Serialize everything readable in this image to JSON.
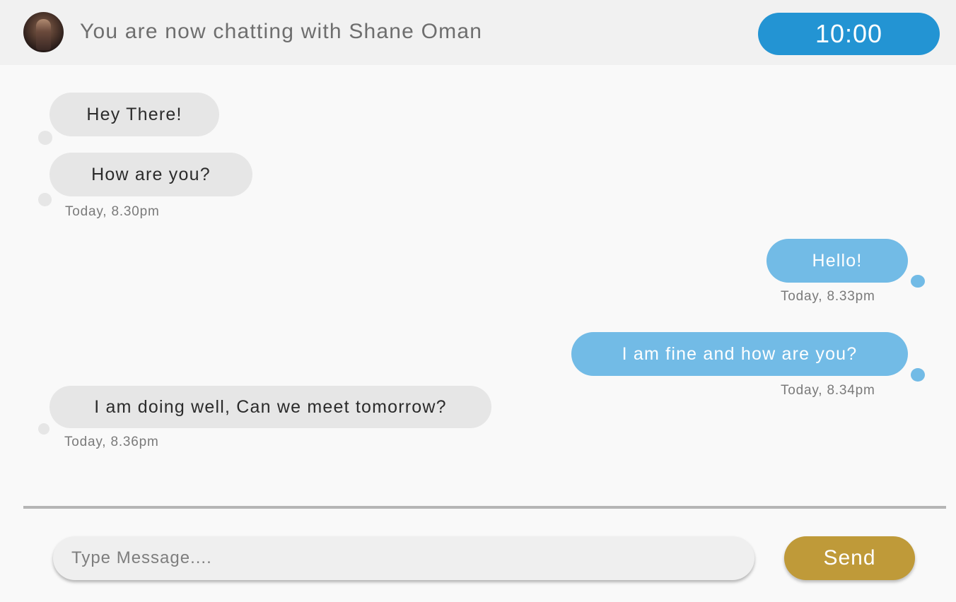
{
  "header": {
    "title": "You are now chatting with Shane Oman",
    "timer": "10:00",
    "avatar_icon": "avatar-photo"
  },
  "messages": [
    {
      "direction": "incoming",
      "text": "Hey There!"
    },
    {
      "direction": "incoming",
      "text": "How are you?",
      "timestamp": "Today, 8.30pm"
    },
    {
      "direction": "outgoing",
      "text": "Hello!",
      "timestamp": "Today, 8.33pm"
    },
    {
      "direction": "outgoing",
      "text": "I am fine and how are you?",
      "timestamp": "Today, 8.34pm"
    },
    {
      "direction": "incoming",
      "text": "I am doing well, Can we meet tomorrow?",
      "timestamp": "Today, 8.36pm"
    }
  ],
  "composer": {
    "placeholder": "Type Message....",
    "send_label": "Send"
  },
  "colors": {
    "header_bg": "#f1f1f1",
    "timer_bg": "#2394d3",
    "incoming_bubble": "#e6e6e6",
    "outgoing_bubble": "#72bbe6",
    "send_button": "#bf9a39"
  }
}
